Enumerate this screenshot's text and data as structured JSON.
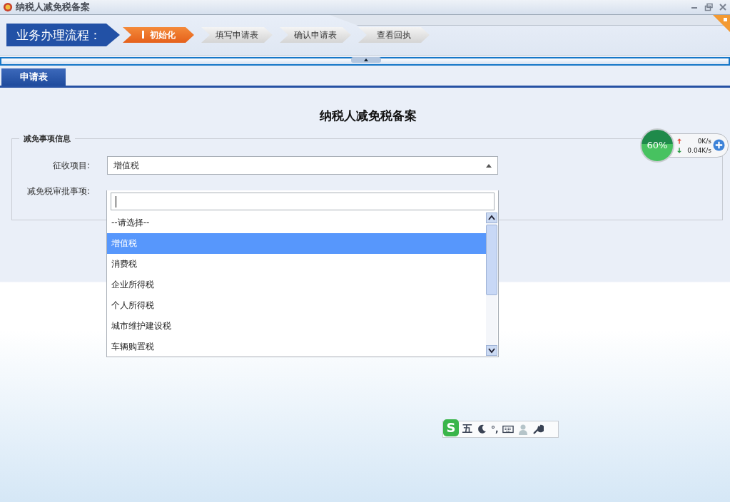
{
  "window": {
    "title": "纳税人减免税备案"
  },
  "process": {
    "label": "业务办理流程：",
    "steps": [
      {
        "label": "初始化",
        "selected": true
      },
      {
        "label": "填写申请表",
        "selected": false
      },
      {
        "label": "确认申请表",
        "selected": false
      },
      {
        "label": "查看回执",
        "selected": false
      }
    ]
  },
  "tabs": [
    {
      "label": "申请表",
      "selected": true
    }
  ],
  "form": {
    "title": "纳税人减免税备案",
    "section": "减免事项信息",
    "fields": [
      {
        "label": "征收项目:",
        "value": "增值税"
      },
      {
        "label": "减免税审批事项:"
      }
    ],
    "dropdown": {
      "options": [
        {
          "label": "--请选择--",
          "selected": false
        },
        {
          "label": "增值税",
          "selected": true
        },
        {
          "label": "消费税",
          "selected": false
        },
        {
          "label": "企业所得税",
          "selected": false
        },
        {
          "label": "个人所得税",
          "selected": false
        },
        {
          "label": "城市维护建设税",
          "selected": false
        },
        {
          "label": "车辆购置税",
          "selected": false
        }
      ]
    }
  },
  "network_widget": {
    "percent": "60%",
    "upload": "0K/s",
    "download": "0.04K/s"
  },
  "ime_toolbar": {
    "logo": "S",
    "mode": "五",
    "punct": "°,"
  }
}
